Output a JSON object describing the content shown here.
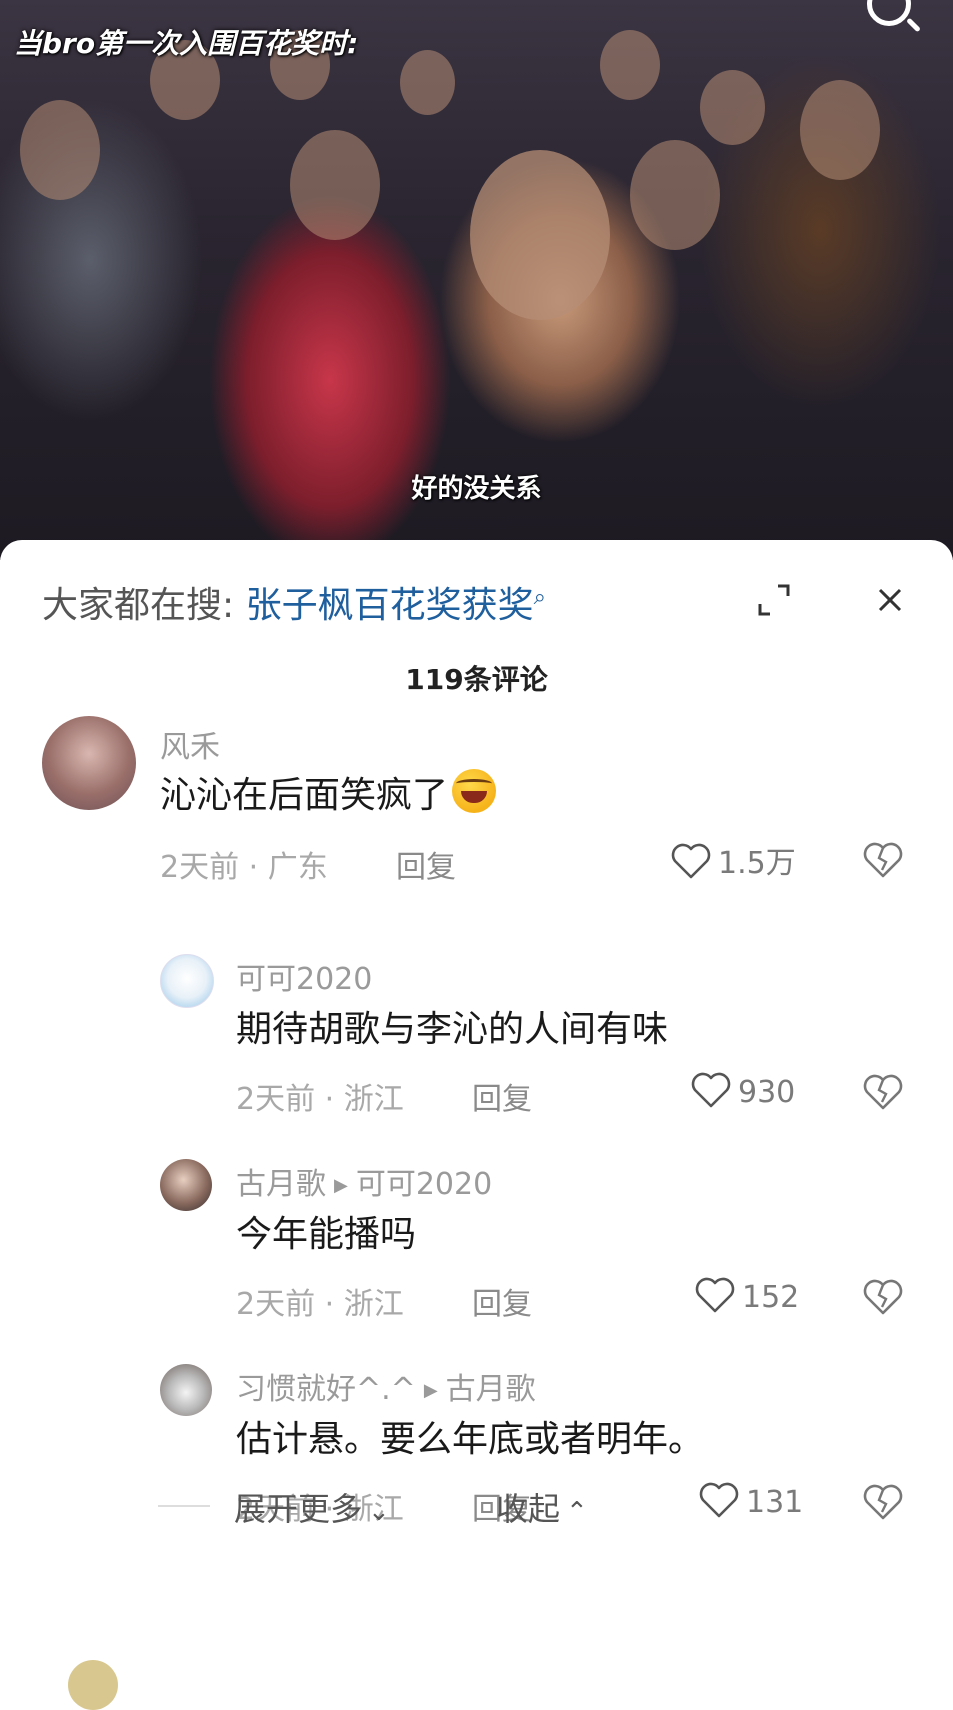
{
  "video": {
    "top_caption": "当bro第一次入围百花奖时:",
    "subtitle": "好的没关系"
  },
  "search": {
    "prefix": "大家都在搜:",
    "term": "张子枫百花奖获奖"
  },
  "comment_count": "119条评论",
  "comments": [
    {
      "user": "风禾",
      "text": "沁沁在后面笑疯了",
      "meta": "2天前 · 广东",
      "reply": "回复",
      "likes": "1.5万"
    },
    {
      "user": "可可2020",
      "text": "期待胡歌与李沁的人间有味",
      "meta": "2天前 · 浙江",
      "reply": "回复",
      "likes": "930"
    },
    {
      "user": "古月歌",
      "reply_to": "可可2020",
      "text": "今年能播吗",
      "meta": "2天前 · 浙江",
      "reply": "回复",
      "likes": "152"
    },
    {
      "user": "习惯就好^.^",
      "reply_to": "古月歌",
      "text": "估计悬。要么年底或者明年。",
      "meta": "2天前 · 浙江",
      "reply": "回复",
      "likes": "131"
    }
  ],
  "footer": {
    "expand_more": "展开更多",
    "collapse": "收起"
  },
  "icons": {
    "like": "heart-outline-icon",
    "dislike": "broken-heart-icon",
    "expand": "expand-icon",
    "close": "close-icon",
    "search": "search-icon"
  },
  "colors": {
    "search_term": "#1f5f9e",
    "meta_text": "#a8a8a8",
    "body_text": "#1a1a1a"
  }
}
